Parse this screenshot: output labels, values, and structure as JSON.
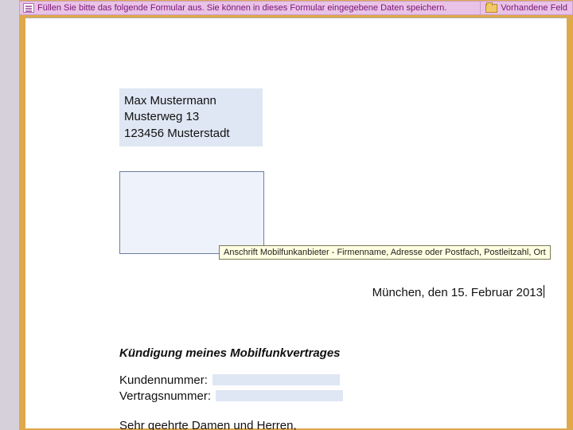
{
  "topbar": {
    "message": "Füllen Sie bitte das folgende Formular aus. Sie können in dieses Formular eingegebene Daten speichern.",
    "highlight_button": "Vorhandene Feld"
  },
  "sender": {
    "name": "Max Mustermann",
    "street": "Musterweg 13",
    "city": "123456 Musterstadt"
  },
  "recipient": {
    "tooltip": "Anschrift Mobilfunkanbieter - Firmenname, Adresse oder Postfach, Postleitzahl, Ort"
  },
  "dateline": "München, den 15. Februar 2013",
  "body": {
    "subject": "Kündigung meines Mobilfunkvertrages",
    "customer_no_label": "Kundennummer:",
    "contract_no_label": "Vertragsnummer:",
    "greeting": "Sehr geehrte Damen und Herren,"
  }
}
